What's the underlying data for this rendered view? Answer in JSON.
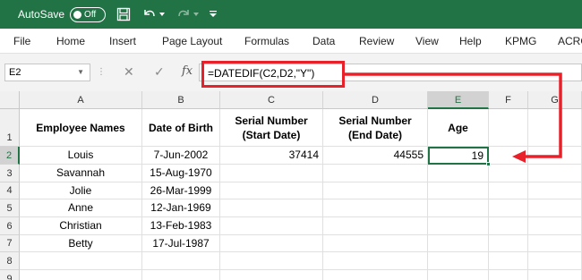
{
  "titlebar": {
    "autosave_label": "AutoSave",
    "toggle_state": "Off"
  },
  "menu": [
    "File",
    "Home",
    "Insert",
    "Page Layout",
    "Formulas",
    "Data",
    "Review",
    "View",
    "Help",
    "KPMG",
    "ACRO"
  ],
  "formula_bar": {
    "name_box": "E2",
    "cancel_symbol": "✕",
    "enter_symbol": "✓",
    "fx_symbol": "fx",
    "formula": "=DATEDIF(C2,D2,\"Y\")"
  },
  "columns": [
    "A",
    "B",
    "C",
    "D",
    "E",
    "F",
    "G"
  ],
  "selected_column": "E",
  "rows": [
    "1",
    "2",
    "3",
    "4",
    "5",
    "6",
    "7",
    "8",
    "9"
  ],
  "selected_row": "2",
  "headers": {
    "a": "Employee Names",
    "b": "Date of Birth",
    "c": "Serial Number (Start Date)",
    "d": "Serial Number (End Date)",
    "e": "Age"
  },
  "data": [
    {
      "name": "Louis",
      "dob": "7-Jun-2002",
      "start": "37414",
      "end": "44555",
      "age": "19"
    },
    {
      "name": "Savannah",
      "dob": "15-Aug-1970",
      "start": "",
      "end": "",
      "age": ""
    },
    {
      "name": "Jolie",
      "dob": "26-Mar-1999",
      "start": "",
      "end": "",
      "age": ""
    },
    {
      "name": "Anne",
      "dob": "12-Jan-1969",
      "start": "",
      "end": "",
      "age": ""
    },
    {
      "name": "Christian",
      "dob": "13-Feb-1983",
      "start": "",
      "end": "",
      "age": ""
    },
    {
      "name": "Betty",
      "dob": "17-Jul-1987",
      "start": "",
      "end": "",
      "age": ""
    }
  ],
  "colors": {
    "excel_green": "#217346",
    "annotation_red": "#e8202a"
  }
}
